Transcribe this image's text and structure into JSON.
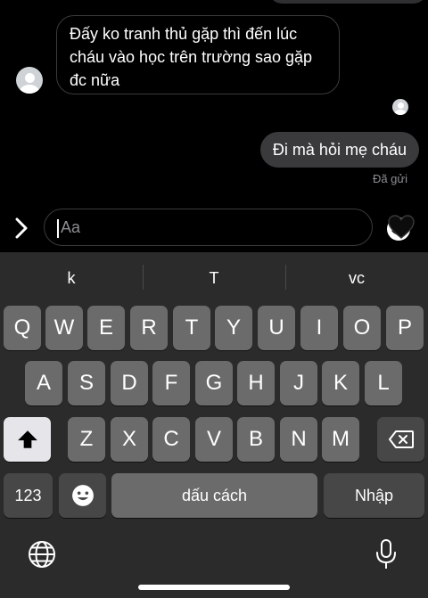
{
  "chat": {
    "incoming_message": "Đấy ko tranh thủ gặp thì đến lúc cháu vào học trên trường sao gặp đc nữa",
    "outgoing_message": "Đi mà hỏi mẹ cháu",
    "status": "Đã gửi"
  },
  "composer": {
    "placeholder": "Aa",
    "icons": [
      "chevron-right-icon",
      "emoji-icon",
      "heart-icon"
    ]
  },
  "keyboard": {
    "suggestions": [
      "k",
      "T",
      "vc"
    ],
    "row1": [
      "Q",
      "W",
      "E",
      "R",
      "T",
      "Y",
      "U",
      "I",
      "O",
      "P"
    ],
    "row2": [
      "A",
      "S",
      "D",
      "F",
      "G",
      "H",
      "J",
      "K",
      "L"
    ],
    "row3": [
      "Z",
      "X",
      "C",
      "V",
      "B",
      "N",
      "M"
    ],
    "numbers_label": "123",
    "space_label": "dấu cách",
    "return_label": "Nhập",
    "icons": [
      "shift-icon",
      "backspace-icon",
      "emoji-icon",
      "globe-icon",
      "microphone-icon"
    ]
  }
}
